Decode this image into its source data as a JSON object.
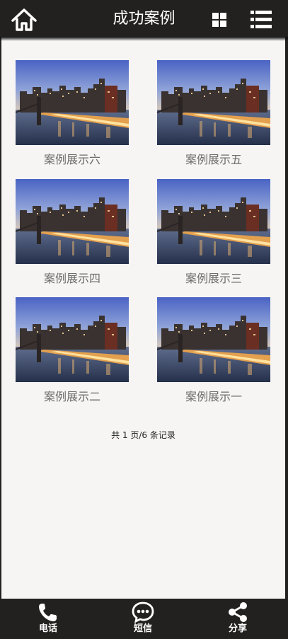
{
  "header": {
    "title": "成功案例"
  },
  "cases": [
    {
      "label": "案例展示六"
    },
    {
      "label": "案例展示五"
    },
    {
      "label": "案例展示四"
    },
    {
      "label": "案例展示三"
    },
    {
      "label": "案例展示二"
    },
    {
      "label": "案例展示一"
    }
  ],
  "pagination": {
    "text": "共 1 页/6 条记录"
  },
  "footer": {
    "phone_label": "电话",
    "sms_label": "短信",
    "share_label": "分享"
  },
  "colors": {
    "bar": "#232120",
    "content_bg": "#f7f5f4",
    "label": "#6c6c6c"
  },
  "icons": {
    "home": "home-icon",
    "grid": "grid-icon",
    "list": "list-icon",
    "phone": "phone-icon",
    "sms": "chat-bubble-icon",
    "share": "share-icon"
  }
}
